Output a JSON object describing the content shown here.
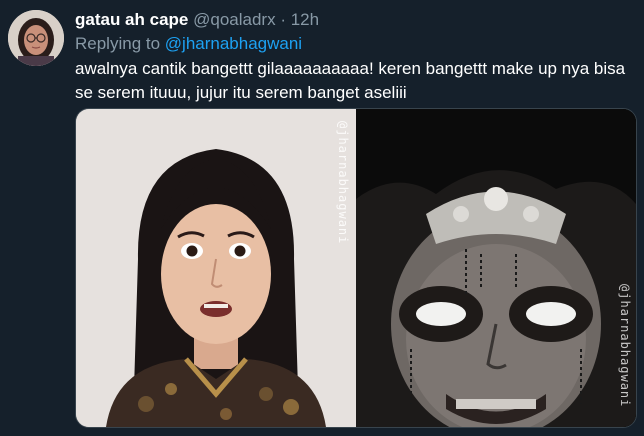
{
  "tweet": {
    "display_name": "gatau ah cape",
    "handle": "@qoaladrx",
    "separator": "·",
    "time": "12h",
    "replying_prefix": "Replying to ",
    "replying_to": "@jharnabhagwani",
    "text": "awalnya cantik bangettt gilaaaaaaaaaa! keren bangettt make up nya bisa se serem ituuu, jujur itu serem banget aseliii"
  },
  "media": {
    "watermark_left": "@jharnabhagwani",
    "watermark_right": "@jharnabhagwani"
  },
  "colors": {
    "background": "#15202b",
    "secondary_text": "#8899a6",
    "link": "#1da1f2"
  }
}
